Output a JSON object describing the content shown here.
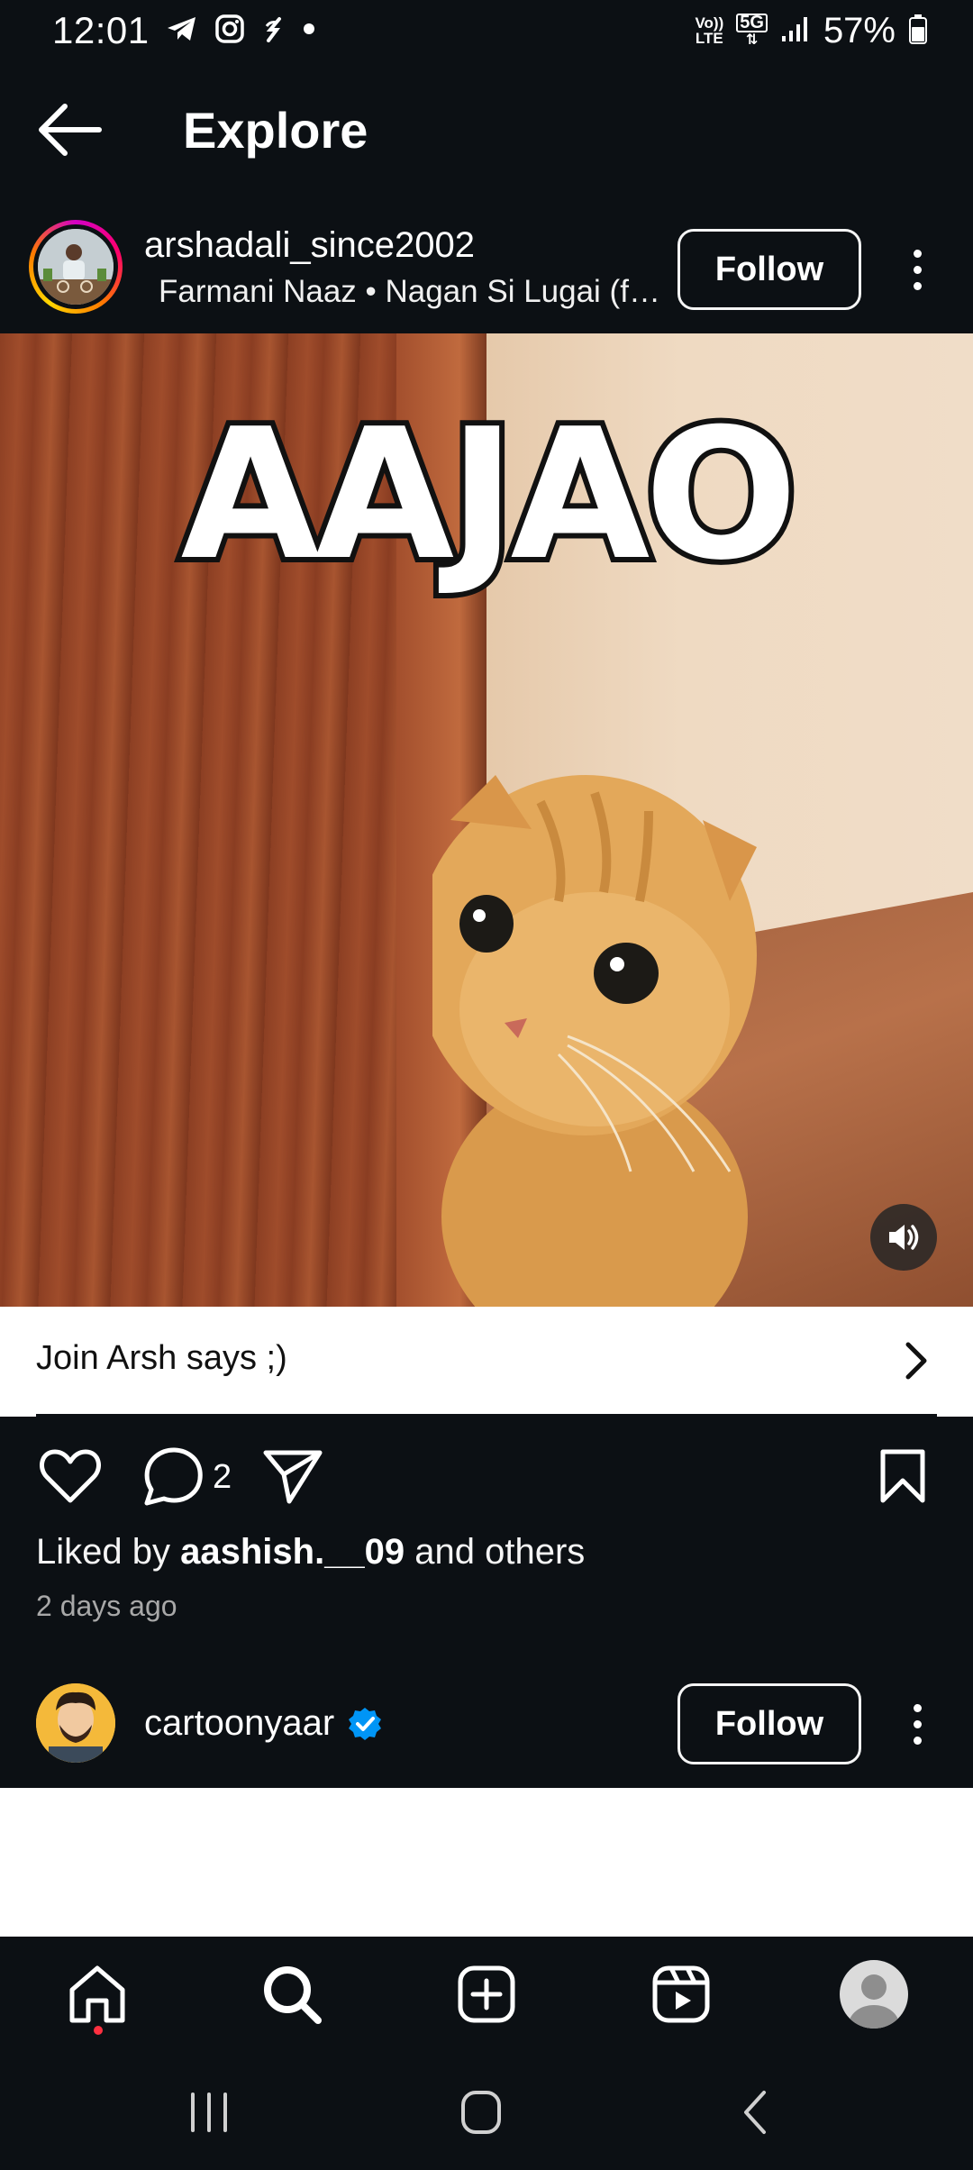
{
  "status_bar": {
    "time": "12:01",
    "battery": "57%",
    "network_top": "Vo))",
    "network_bottom": "LTE",
    "network_type": "5G"
  },
  "header": {
    "title": "Explore"
  },
  "post": {
    "username": "arshadali_since2002",
    "audio": "Farmani Naaz • Nagan Si Lugai (f…",
    "follow_label": "Follow",
    "overlay_text": "AAJAO",
    "cta_text": "Join Arsh says ;)",
    "comment_count": "2",
    "likes_prefix": "Liked by ",
    "likes_user": "aashish.__09",
    "likes_suffix": " and others",
    "timestamp": "2 days ago"
  },
  "next_post": {
    "username": "cartoonyaar",
    "follow_label": "Follow",
    "verified": true
  },
  "bottom_nav": {
    "items": [
      "home",
      "search",
      "create",
      "reels",
      "profile"
    ],
    "active": "search"
  },
  "colors": {
    "background": "#0c1014",
    "accent_verified": "#0095f6",
    "notification_dot": "#ff3040"
  }
}
